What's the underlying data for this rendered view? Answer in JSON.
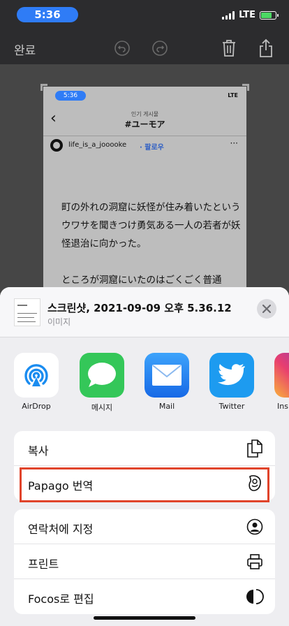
{
  "status": {
    "time": "5:36",
    "network": "LTE"
  },
  "toolbar": {
    "done_label": "완료"
  },
  "preview": {
    "time": "5:36",
    "network": "LTE",
    "category": "인기 게시물",
    "title": "#ユーモア",
    "username": "life_is_a_jooooke",
    "follow": "· 팔로우",
    "more": "···",
    "paragraphs": [
      "町の外れの洞窟に妖怪が住み着いたというウワサを聞きつけ勇気ある一人の若者が妖怪退治に向かった。",
      "ところが洞窟にいたのはごくごく普通"
    ]
  },
  "sheet": {
    "title": "스크린샷, 2021-09-09 오후 5.36.12",
    "subtitle": "이미지"
  },
  "apps": [
    {
      "label": "AirDrop",
      "icon": "airdrop-icon"
    },
    {
      "label": "메시지",
      "icon": "messages-icon"
    },
    {
      "label": "Mail",
      "icon": "mail-icon"
    },
    {
      "label": "Twitter",
      "icon": "twitter-icon"
    },
    {
      "label": "Ins",
      "icon": "instagram-icon"
    }
  ],
  "actions_group1": [
    {
      "label": "복사",
      "icon": "copy-icon"
    },
    {
      "label": "Papago 번역",
      "icon": "papago-icon"
    }
  ],
  "actions_group2": [
    {
      "label": "연락처에 지정",
      "icon": "contact-icon"
    },
    {
      "label": "프린트",
      "icon": "printer-icon"
    },
    {
      "label": "Focos로 편집",
      "icon": "focos-icon"
    }
  ],
  "colors": {
    "accent": "#2f7cf6",
    "highlight": "#e0442b",
    "messages": "#34c759",
    "mail": "#2e8cf6",
    "twitter": "#1d9bf0"
  }
}
